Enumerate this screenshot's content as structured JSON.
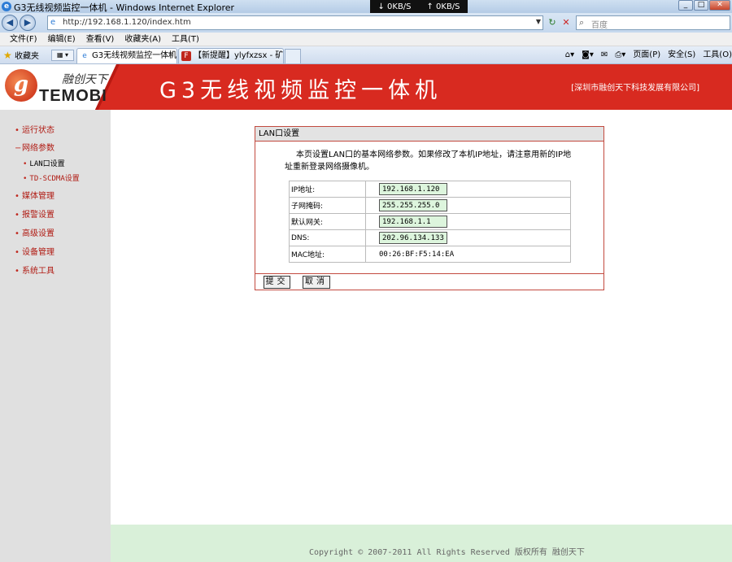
{
  "browser": {
    "window_title": "G3无线视频监控一体机 - Windows Internet Explorer",
    "net_down": "0KB/S",
    "net_up": "0KB/S",
    "url": "http://192.168.1.120/index.htm",
    "search_placeholder": "百度",
    "menu": [
      "文件(F)",
      "编辑(E)",
      "查看(V)",
      "收藏夹(A)",
      "工具(T)"
    ],
    "favorites_label": "收藏夹",
    "tabs": [
      {
        "label": "G3无线视频监控一体机",
        "active": true
      },
      {
        "label": "【新提醒】ylyfxzsx - 矿石...",
        "active": false
      }
    ],
    "commands": [
      "页面(P)",
      "安全(S)",
      "工具(O)"
    ]
  },
  "banner": {
    "logo_cn": "融创天下",
    "logo_en": "TEMOBI",
    "title": "G3无线视频监控一体机",
    "company": "[深圳市融创天下科技发展有限公司]"
  },
  "sidebar": {
    "items": [
      {
        "label": "运行状态"
      },
      {
        "label": "网络参数"
      },
      {
        "label": "媒体管理"
      },
      {
        "label": "报警设置"
      },
      {
        "label": "高级设置"
      },
      {
        "label": "设备管理"
      },
      {
        "label": "系统工具"
      }
    ],
    "subitems": [
      {
        "label": "LAN口设置"
      },
      {
        "label": "TD-SCDMA设置"
      }
    ]
  },
  "lan": {
    "heading": "LAN口设置",
    "description": "本页设置LAN口的基本网络参数。如果修改了本机IP地址，请注意用新的IP地址重新登录网络摄像机。",
    "fields": [
      {
        "label": "IP地址:",
        "value": "192.168.1.120"
      },
      {
        "label": "子网掩码:",
        "value": "255.255.255.0"
      },
      {
        "label": "默认网关:",
        "value": "192.168.1.1"
      },
      {
        "label": "DNS:",
        "value": "202.96.134.133"
      }
    ],
    "mac_label": "MAC地址:",
    "mac_value": "00:26:BF:F5:14:EA",
    "submit": "提交",
    "cancel": "取消"
  },
  "footer": {
    "copyright": "Copyright © 2007-2011 All Rights Reserved 版权所有 融创天下"
  }
}
